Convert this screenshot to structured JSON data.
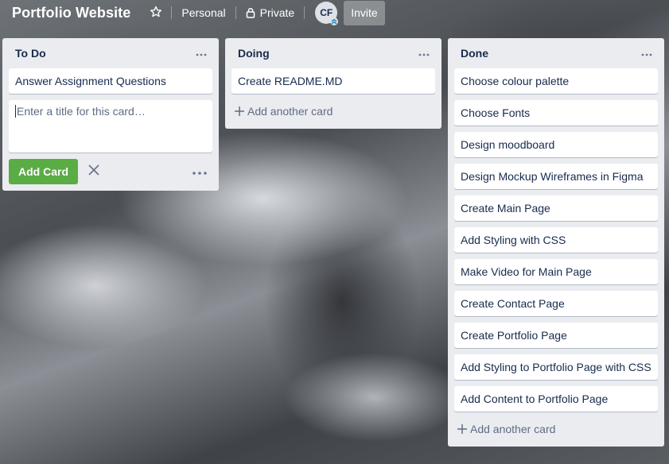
{
  "header": {
    "board_title": "Portfolio Website",
    "star_icon": "star-outline-icon",
    "team_label": "Personal",
    "visibility_label": "Private",
    "avatar_initials": "CF",
    "invite_label": "Invite"
  },
  "lists": [
    {
      "title": "To Do",
      "cards": [
        "Answer Assignment Questions"
      ],
      "composer": {
        "placeholder": "Enter a title for this card…",
        "submit_label": "Add Card"
      }
    },
    {
      "title": "Doing",
      "cards": [
        "Create README.MD"
      ],
      "add_label": "Add another card"
    },
    {
      "title": "Done",
      "cards": [
        "Choose colour palette",
        "Choose Fonts",
        "Design moodboard",
        "Design Mockup Wireframes in Figma",
        "Create Main Page",
        "Add Styling with CSS",
        "Make Video for Main Page",
        "Create Contact Page",
        "Create Portfolio Page",
        "Add Styling to Portfolio Page with CSS",
        "Add Content to Portfolio Page"
      ],
      "add_label": "Add another card"
    }
  ],
  "colors": {
    "list_bg": "#ebecf0",
    "card_text": "#172b4d",
    "add_card_btn": "#5aac44",
    "muted_text": "#5e6c84"
  }
}
